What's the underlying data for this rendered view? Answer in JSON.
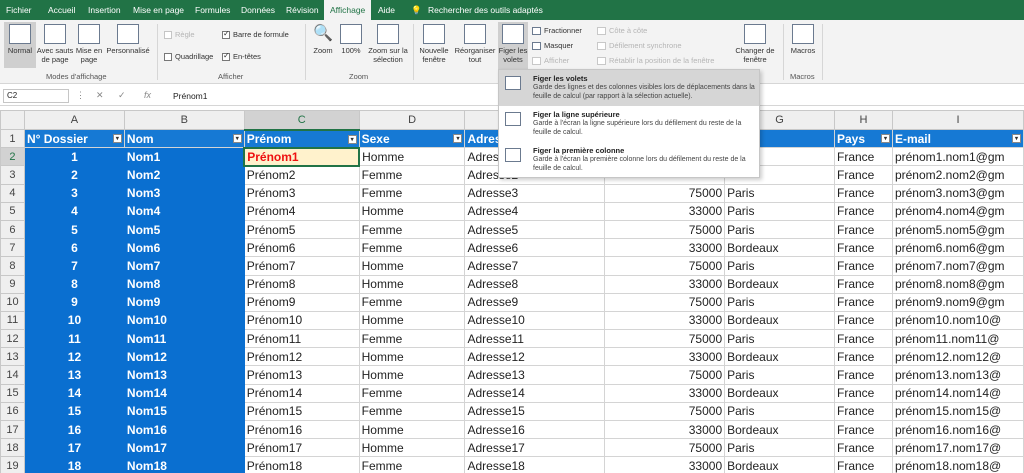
{
  "menu": {
    "tabs": [
      "Fichier",
      "Accueil",
      "Insertion",
      "Mise en page",
      "Formules",
      "Données",
      "Révision",
      "Affichage",
      "Aide"
    ],
    "active_tab": "Affichage",
    "search_label": "Rechercher des outils adaptés"
  },
  "ribbon": {
    "normal": "Normal",
    "sauts": "Avec sauts de page",
    "mise_en_page": "Mise en page",
    "personnalise": "Personnalisé",
    "group_modes": "Modes d'affichage",
    "regle": "Règle",
    "barre_formule": "Barre de formule",
    "quadrillage": "Quadrillage",
    "en_tetes": "En-têtes",
    "group_afficher": "Afficher",
    "zoom": "Zoom",
    "zoom100": "100%",
    "zoom_selection": "Zoom sur la sélection",
    "group_zoom": "Zoom",
    "nouvelle_fenetre": "Nouvelle fenêtre",
    "reorganiser": "Réorganiser tout",
    "figer": "Figer les volets",
    "fractionner": "Fractionner",
    "masquer": "Masquer",
    "afficher": "Afficher",
    "cote_a_cote": "Côte à côte",
    "defilement_sync": "Défilement synchrone",
    "retablir": "Rétablir la position de la fenêtre",
    "changer_fenetre": "Changer de fenêtre",
    "macros": "Macros",
    "group_macros": "Macros"
  },
  "formula_bar": {
    "name_box": "C2",
    "value": "Prénom1"
  },
  "dropdown": {
    "options": [
      {
        "title": "Figer les volets",
        "desc": "Garde des lignes et des colonnes visibles lors de déplacements dans la feuille de calcul (par rapport à la sélection actuelle)."
      },
      {
        "title": "Figer la ligne supérieure",
        "desc": "Garde à l'écran la ligne supérieure lors du défilement du reste de la feuille de calcul."
      },
      {
        "title": "Figer la première colonne",
        "desc": "Garde à l'écran la première colonne lors du défilement du reste de la feuille de calcul."
      }
    ]
  },
  "sheet": {
    "columns": [
      "A",
      "B",
      "C",
      "D",
      "E",
      "F",
      "G",
      "H",
      "I"
    ],
    "headers": [
      "N° Dossier",
      "Nom",
      "Prénom",
      "Sexe",
      "Adresse",
      "",
      "",
      "Pays",
      "E-mail"
    ],
    "rows": [
      [
        "1",
        "Nom1",
        "Prénom1",
        "Homme",
        "Adresse1",
        "",
        "",
        "France",
        "prénom1.nom1@gm"
      ],
      [
        "2",
        "Nom2",
        "Prénom2",
        "Femme",
        "Adresse2",
        "",
        "",
        "France",
        "prénom2.nom2@gm"
      ],
      [
        "3",
        "Nom3",
        "Prénom3",
        "Femme",
        "Adresse3",
        "75000",
        "Paris",
        "France",
        "prénom3.nom3@gm"
      ],
      [
        "4",
        "Nom4",
        "Prénom4",
        "Homme",
        "Adresse4",
        "33000",
        "Paris",
        "France",
        "prénom4.nom4@gm"
      ],
      [
        "5",
        "Nom5",
        "Prénom5",
        "Femme",
        "Adresse5",
        "75000",
        "Paris",
        "France",
        "prénom5.nom5@gm"
      ],
      [
        "6",
        "Nom6",
        "Prénom6",
        "Femme",
        "Adresse6",
        "33000",
        "Bordeaux",
        "France",
        "prénom6.nom6@gm"
      ],
      [
        "7",
        "Nom7",
        "Prénom7",
        "Homme",
        "Adresse7",
        "75000",
        "Paris",
        "France",
        "prénom7.nom7@gm"
      ],
      [
        "8",
        "Nom8",
        "Prénom8",
        "Homme",
        "Adresse8",
        "33000",
        "Bordeaux",
        "France",
        "prénom8.nom8@gm"
      ],
      [
        "9",
        "Nom9",
        "Prénom9",
        "Femme",
        "Adresse9",
        "75000",
        "Paris",
        "France",
        "prénom9.nom9@gm"
      ],
      [
        "10",
        "Nom10",
        "Prénom10",
        "Homme",
        "Adresse10",
        "33000",
        "Bordeaux",
        "France",
        "prénom10.nom10@"
      ],
      [
        "11",
        "Nom11",
        "Prénom11",
        "Femme",
        "Adresse11",
        "75000",
        "Paris",
        "France",
        "prénom11.nom11@"
      ],
      [
        "12",
        "Nom12",
        "Prénom12",
        "Homme",
        "Adresse12",
        "33000",
        "Bordeaux",
        "France",
        "prénom12.nom12@"
      ],
      [
        "13",
        "Nom13",
        "Prénom13",
        "Homme",
        "Adresse13",
        "75000",
        "Paris",
        "France",
        "prénom13.nom13@"
      ],
      [
        "14",
        "Nom14",
        "Prénom14",
        "Femme",
        "Adresse14",
        "33000",
        "Bordeaux",
        "France",
        "prénom14.nom14@"
      ],
      [
        "15",
        "Nom15",
        "Prénom15",
        "Femme",
        "Adresse15",
        "75000",
        "Paris",
        "France",
        "prénom15.nom15@"
      ],
      [
        "16",
        "Nom16",
        "Prénom16",
        "Homme",
        "Adresse16",
        "33000",
        "Bordeaux",
        "France",
        "prénom16.nom16@"
      ],
      [
        "17",
        "Nom17",
        "Prénom17",
        "Homme",
        "Adresse17",
        "75000",
        "Paris",
        "France",
        "prénom17.nom17@"
      ],
      [
        "18",
        "Nom18",
        "Prénom18",
        "Femme",
        "Adresse18",
        "33000",
        "Bordeaux",
        "France",
        "prénom18.nom18@"
      ]
    ]
  },
  "colors": {
    "ribbon_green": "#217346",
    "header_blue": "#1679d4",
    "frozen_blue": "#0a6fd0",
    "active_text": "#e11111"
  }
}
